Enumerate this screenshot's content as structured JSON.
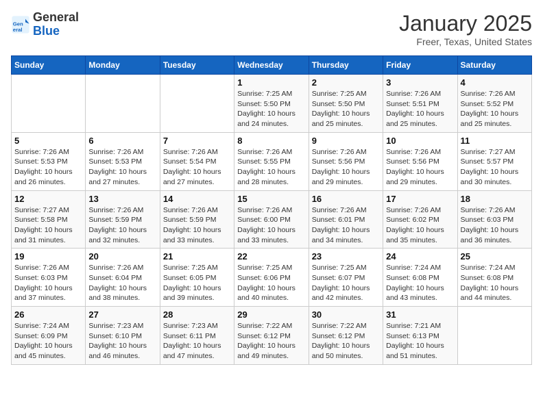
{
  "header": {
    "logo_line1": "General",
    "logo_line2": "Blue",
    "month": "January 2025",
    "location": "Freer, Texas, United States"
  },
  "days_of_week": [
    "Sunday",
    "Monday",
    "Tuesday",
    "Wednesday",
    "Thursday",
    "Friday",
    "Saturday"
  ],
  "weeks": [
    [
      {
        "day": "",
        "info": ""
      },
      {
        "day": "",
        "info": ""
      },
      {
        "day": "",
        "info": ""
      },
      {
        "day": "1",
        "info": "Sunrise: 7:25 AM\nSunset: 5:50 PM\nDaylight: 10 hours and 24 minutes."
      },
      {
        "day": "2",
        "info": "Sunrise: 7:25 AM\nSunset: 5:50 PM\nDaylight: 10 hours and 25 minutes."
      },
      {
        "day": "3",
        "info": "Sunrise: 7:26 AM\nSunset: 5:51 PM\nDaylight: 10 hours and 25 minutes."
      },
      {
        "day": "4",
        "info": "Sunrise: 7:26 AM\nSunset: 5:52 PM\nDaylight: 10 hours and 25 minutes."
      }
    ],
    [
      {
        "day": "5",
        "info": "Sunrise: 7:26 AM\nSunset: 5:53 PM\nDaylight: 10 hours and 26 minutes."
      },
      {
        "day": "6",
        "info": "Sunrise: 7:26 AM\nSunset: 5:53 PM\nDaylight: 10 hours and 27 minutes."
      },
      {
        "day": "7",
        "info": "Sunrise: 7:26 AM\nSunset: 5:54 PM\nDaylight: 10 hours and 27 minutes."
      },
      {
        "day": "8",
        "info": "Sunrise: 7:26 AM\nSunset: 5:55 PM\nDaylight: 10 hours and 28 minutes."
      },
      {
        "day": "9",
        "info": "Sunrise: 7:26 AM\nSunset: 5:56 PM\nDaylight: 10 hours and 29 minutes."
      },
      {
        "day": "10",
        "info": "Sunrise: 7:26 AM\nSunset: 5:56 PM\nDaylight: 10 hours and 29 minutes."
      },
      {
        "day": "11",
        "info": "Sunrise: 7:27 AM\nSunset: 5:57 PM\nDaylight: 10 hours and 30 minutes."
      }
    ],
    [
      {
        "day": "12",
        "info": "Sunrise: 7:27 AM\nSunset: 5:58 PM\nDaylight: 10 hours and 31 minutes."
      },
      {
        "day": "13",
        "info": "Sunrise: 7:26 AM\nSunset: 5:59 PM\nDaylight: 10 hours and 32 minutes."
      },
      {
        "day": "14",
        "info": "Sunrise: 7:26 AM\nSunset: 5:59 PM\nDaylight: 10 hours and 33 minutes."
      },
      {
        "day": "15",
        "info": "Sunrise: 7:26 AM\nSunset: 6:00 PM\nDaylight: 10 hours and 33 minutes."
      },
      {
        "day": "16",
        "info": "Sunrise: 7:26 AM\nSunset: 6:01 PM\nDaylight: 10 hours and 34 minutes."
      },
      {
        "day": "17",
        "info": "Sunrise: 7:26 AM\nSunset: 6:02 PM\nDaylight: 10 hours and 35 minutes."
      },
      {
        "day": "18",
        "info": "Sunrise: 7:26 AM\nSunset: 6:03 PM\nDaylight: 10 hours and 36 minutes."
      }
    ],
    [
      {
        "day": "19",
        "info": "Sunrise: 7:26 AM\nSunset: 6:03 PM\nDaylight: 10 hours and 37 minutes."
      },
      {
        "day": "20",
        "info": "Sunrise: 7:26 AM\nSunset: 6:04 PM\nDaylight: 10 hours and 38 minutes."
      },
      {
        "day": "21",
        "info": "Sunrise: 7:25 AM\nSunset: 6:05 PM\nDaylight: 10 hours and 39 minutes."
      },
      {
        "day": "22",
        "info": "Sunrise: 7:25 AM\nSunset: 6:06 PM\nDaylight: 10 hours and 40 minutes."
      },
      {
        "day": "23",
        "info": "Sunrise: 7:25 AM\nSunset: 6:07 PM\nDaylight: 10 hours and 42 minutes."
      },
      {
        "day": "24",
        "info": "Sunrise: 7:24 AM\nSunset: 6:08 PM\nDaylight: 10 hours and 43 minutes."
      },
      {
        "day": "25",
        "info": "Sunrise: 7:24 AM\nSunset: 6:08 PM\nDaylight: 10 hours and 44 minutes."
      }
    ],
    [
      {
        "day": "26",
        "info": "Sunrise: 7:24 AM\nSunset: 6:09 PM\nDaylight: 10 hours and 45 minutes."
      },
      {
        "day": "27",
        "info": "Sunrise: 7:23 AM\nSunset: 6:10 PM\nDaylight: 10 hours and 46 minutes."
      },
      {
        "day": "28",
        "info": "Sunrise: 7:23 AM\nSunset: 6:11 PM\nDaylight: 10 hours and 47 minutes."
      },
      {
        "day": "29",
        "info": "Sunrise: 7:22 AM\nSunset: 6:12 PM\nDaylight: 10 hours and 49 minutes."
      },
      {
        "day": "30",
        "info": "Sunrise: 7:22 AM\nSunset: 6:12 PM\nDaylight: 10 hours and 50 minutes."
      },
      {
        "day": "31",
        "info": "Sunrise: 7:21 AM\nSunset: 6:13 PM\nDaylight: 10 hours and 51 minutes."
      },
      {
        "day": "",
        "info": ""
      }
    ]
  ]
}
